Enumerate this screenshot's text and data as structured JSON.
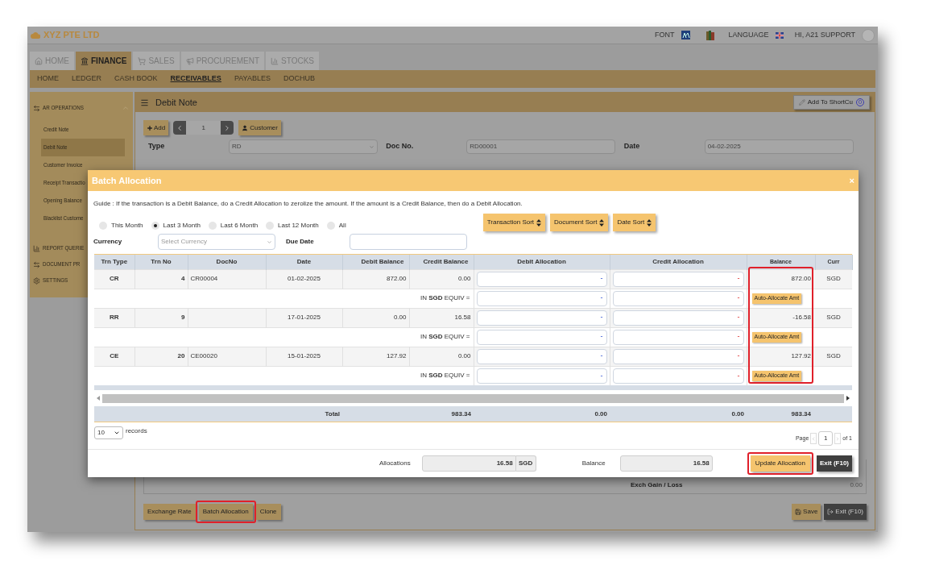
{
  "header": {
    "company": "XYZ PTE LTD",
    "font_label": "FONT",
    "language_label": "LANGUAGE",
    "greeting": "HI, A21 SUPPORT"
  },
  "main_tabs": [
    {
      "label": "HOME",
      "selected": false
    },
    {
      "label": "FINANCE",
      "selected": true
    },
    {
      "label": "SALES",
      "selected": false
    },
    {
      "label": "PROCUREMENT",
      "selected": false
    },
    {
      "label": "STOCKS",
      "selected": false
    }
  ],
  "sub_nav": [
    {
      "label": "HOME",
      "selected": false
    },
    {
      "label": "LEDGER",
      "selected": false
    },
    {
      "label": "CASH BOOK",
      "selected": false
    },
    {
      "label": "RECEIVABLES",
      "selected": true
    },
    {
      "label": "PAYABLES",
      "selected": false
    },
    {
      "label": "DOCHUB",
      "selected": false
    }
  ],
  "sidebar": {
    "sections": [
      {
        "title": "AR OPERATIONS",
        "items": [
          {
            "label": "Credit Note",
            "selected": false
          },
          {
            "label": "Debit Note",
            "selected": true
          },
          {
            "label": "Customer Invoice",
            "selected": false
          },
          {
            "label": "Receipt Transactio",
            "selected": false
          },
          {
            "label": "Opening Balance",
            "selected": false
          },
          {
            "label": "Blacklist Custome",
            "selected": false
          }
        ]
      },
      {
        "title": "REPORT QUERIE"
      },
      {
        "title": "DOCUMENT PR"
      },
      {
        "title": "SETTINGS"
      }
    ]
  },
  "page": {
    "title": "Debit Note",
    "shortcut_button": "Add To ShortCu",
    "shortcut_count": "0",
    "add_button": "Add",
    "record": "1",
    "customer_button": "Customer",
    "fields": [
      {
        "label": "Type",
        "value": "RD",
        "kind": "select"
      },
      {
        "label": "Doc No.",
        "value": "RD00001",
        "kind": "text"
      },
      {
        "label": "Date",
        "value": "04-02-2025",
        "kind": "text"
      }
    ],
    "exch_label": "Exch Gain / Loss",
    "exch_value": "0.00",
    "bottom_buttons": [
      {
        "label": "Exchange Rate",
        "highlighted": false
      },
      {
        "label": "Batch Allocation",
        "highlighted": true
      },
      {
        "label": "Clone",
        "highlighted": false
      }
    ],
    "right_buttons": [
      {
        "label": "Save",
        "kind": "save"
      },
      {
        "label": "Exit (F10)",
        "kind": "exit"
      }
    ]
  },
  "modal": {
    "title": "Batch Allocation",
    "close": "×",
    "guide": "Guide : If the transaction is a Debit Balance, do a Credit Allocation to zerolize the amount. If the amount is a Credit Balance, then do a Debit Allocation.",
    "periods": [
      {
        "label": "This Month",
        "selected": false
      },
      {
        "label": "Last 3 Month",
        "selected": true
      },
      {
        "label": "Last 6 Month",
        "selected": false
      },
      {
        "label": "Last 12 Month",
        "selected": false
      },
      {
        "label": "All",
        "selected": false
      }
    ],
    "sort_buttons": [
      "Transaction Sort",
      "Document Sort",
      "Date Sort"
    ],
    "currency_label": "Currency",
    "currency_placeholder": "Select Currency",
    "due_date_label": "Due Date",
    "table": {
      "columns": [
        {
          "label": "Trn Type",
          "highlighted": false
        },
        {
          "label": "Trn No",
          "highlighted": false
        },
        {
          "label": "DocNo",
          "highlighted": false
        },
        {
          "label": "Date",
          "highlighted": false
        },
        {
          "label": "Debit Balance",
          "highlighted": false
        },
        {
          "label": "Credit Balance",
          "highlighted": false
        },
        {
          "label": "Debit Allocation",
          "highlighted": false
        },
        {
          "label": "Credit Allocation",
          "highlighted": false
        },
        {
          "label": "Balance",
          "highlighted": true
        },
        {
          "label": "Curr",
          "highlighted": false
        }
      ],
      "rows": [
        {
          "trn_type": "CR",
          "trn_no": "4",
          "doc_no": "CR00004",
          "date": "01-02-2025",
          "debit_balance": "872.00",
          "credit_balance": "0.00",
          "debit_input": "-",
          "credit_input": "-",
          "balance": "872.00",
          "curr": "SGD",
          "equiv_label": "IN **SGD** EQUIV =",
          "equiv_debit_input": "-",
          "equiv_credit_input": "-",
          "auto_button": "Auto-Allocate Amt"
        },
        {
          "trn_type": "RR",
          "trn_no": "9",
          "date": "17-01-2025",
          "debit_balance": "0.00",
          "credit_balance": "16.58",
          "debit_input": "-",
          "credit_input": "-",
          "balance": "-16.58",
          "curr": "SGD",
          "equiv_label": "IN **SGD** EQUIV =",
          "equiv_debit_input": "-",
          "equiv_credit_input": "-",
          "auto_button": "Auto-Allocate Amt"
        },
        {
          "trn_type": "CE",
          "trn_no": "20",
          "doc_no": "CE00020",
          "date": "15-01-2025",
          "debit_balance": "127.92",
          "credit_balance": "0.00",
          "debit_input": "-",
          "credit_input": "-",
          "balance": "127.92",
          "curr": "SGD",
          "equiv_label": "IN **SGD** EQUIV =",
          "equiv_debit_input": "-",
          "equiv_credit_input": "-",
          "auto_button": "Auto-Allocate Amt"
        }
      ],
      "total": {
        "label": "Total",
        "credit_balance": "983.34",
        "debit_allocation": "0.00",
        "credit_allocation": "0.00",
        "balance": "983.34"
      }
    },
    "page_size": "10",
    "records_label": "records",
    "page_label": "Page",
    "page": "1",
    "of_pages": "of 1",
    "allocations_label": "Allocations",
    "allocations_value": "16.58",
    "allocations_currency": "SGD",
    "balance_label": "Balance",
    "balance_value": "16.58",
    "update_button": {
      "label": "Update Allocation",
      "highlighted": true
    },
    "exit_button": "Exit (F10)"
  }
}
